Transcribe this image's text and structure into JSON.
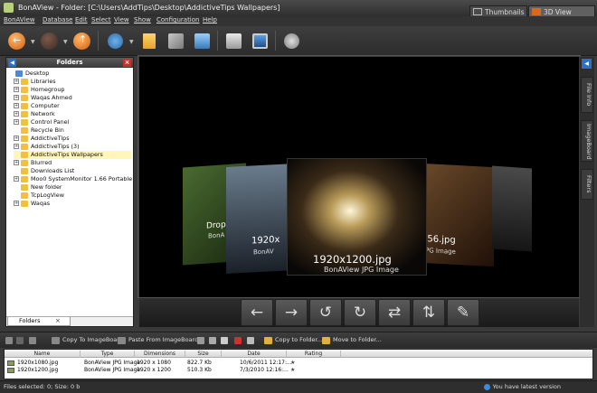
{
  "window": {
    "title": "BonAView - Folder: [C:\\Users\\AddTips\\Desktop\\AddictiveTips Wallpapers]"
  },
  "menu": [
    "BonAView",
    "Database",
    "Edit",
    "Select",
    "View",
    "Show",
    "Configuration",
    "Help"
  ],
  "view_tabs": {
    "thumbnails": "Thumbnails",
    "view3d": "3D View"
  },
  "toolbar": {
    "icons": [
      "back-icon",
      "forward-icon",
      "up-icon",
      "globe-icon",
      "folder-icon",
      "edit-icon",
      "slideshow-icon",
      "print-icon",
      "monitor-icon",
      "settings-icon"
    ]
  },
  "folders_panel": {
    "title": "Folders",
    "tab": "Folders",
    "tree": [
      {
        "label": "Desktop",
        "indent": 0,
        "expander": "",
        "selected": false
      },
      {
        "label": "Libraries",
        "indent": 1,
        "expander": "+",
        "selected": false
      },
      {
        "label": "Homegroup",
        "indent": 1,
        "expander": "+",
        "selected": false
      },
      {
        "label": "Waqas Ahmed",
        "indent": 1,
        "expander": "+",
        "selected": false
      },
      {
        "label": "Computer",
        "indent": 1,
        "expander": "+",
        "selected": false
      },
      {
        "label": "Network",
        "indent": 1,
        "expander": "+",
        "selected": false
      },
      {
        "label": "Control Panel",
        "indent": 1,
        "expander": "+",
        "selected": false
      },
      {
        "label": "Recycle Bin",
        "indent": 1,
        "expander": "",
        "selected": false
      },
      {
        "label": "AddictiveTips",
        "indent": 1,
        "expander": "+",
        "selected": false
      },
      {
        "label": "AddictiveTips (3)",
        "indent": 1,
        "expander": "+",
        "selected": false
      },
      {
        "label": "AddictiveTips Wallpapers",
        "indent": 1,
        "expander": "",
        "selected": true
      },
      {
        "label": "Blurred",
        "indent": 1,
        "expander": "+",
        "selected": false
      },
      {
        "label": "Downloads List",
        "indent": 1,
        "expander": "",
        "selected": false
      },
      {
        "label": "Moo0 SystemMonitor 1.66 Portable",
        "indent": 1,
        "expander": "+",
        "selected": false
      },
      {
        "label": "New folder",
        "indent": 1,
        "expander": "",
        "selected": false
      },
      {
        "label": "TcpLogView",
        "indent": 1,
        "expander": "",
        "selected": false
      },
      {
        "label": "Waqas",
        "indent": 1,
        "expander": "+",
        "selected": false
      }
    ]
  },
  "viewer": {
    "center": {
      "resolution": "1920x1200.jpg",
      "type": "BonAView JPG Image"
    },
    "left1": {
      "resolution": "1920x",
      "type": "BonAV"
    },
    "left2": {
      "resolution": "Drop",
      "type": "BonA"
    },
    "right1": {
      "resolution": "456.jpg",
      "type": "JPG Image"
    }
  },
  "side_tabs": [
    "File Info",
    "ImageBoard",
    "Filters"
  ],
  "bottom_toolbar": {
    "copy_to_imageboard": "Copy To ImageBoard",
    "paste_from_imageboard": "Paste From ImageBoard",
    "copy_to_folder": "Copy to Folder...",
    "move_to_folder": "Move to Folder..."
  },
  "file_list": {
    "columns": [
      "Name",
      "Type",
      "Dimensions",
      "Size",
      "Date",
      "Rating"
    ],
    "rows": [
      {
        "name": "1920x1080.jpg",
        "type": "BonAView JPG Image",
        "dimensions": "1920 x 1080",
        "size": "822.7 Kb",
        "date": "10/6/2011 12:17:..."
      },
      {
        "name": "1920x1200.jpg",
        "type": "BonAView JPG Image",
        "dimensions": "1920 x 1200",
        "size": "510.3 Kb",
        "date": "7/3/2010 12:16:..."
      }
    ]
  },
  "status": {
    "left": "Files selected: 0; Size: 0 b",
    "right": "You have latest version"
  }
}
